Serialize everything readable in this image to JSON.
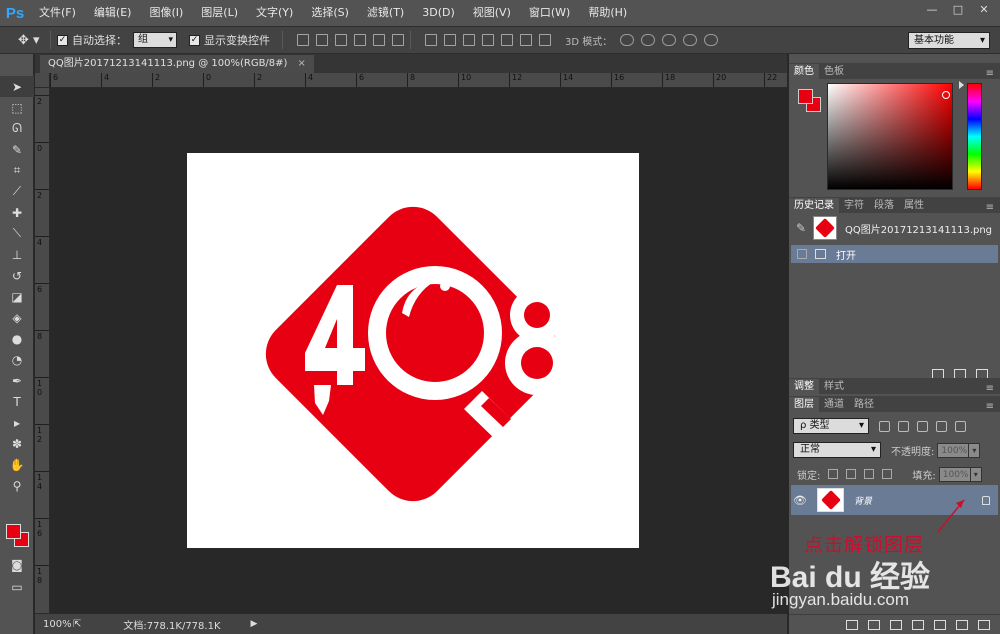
{
  "menubar": {
    "logo": "Ps",
    "items": [
      "文件(F)",
      "编辑(E)",
      "图像(I)",
      "图层(L)",
      "文字(Y)",
      "选择(S)",
      "滤镜(T)",
      "3D(D)",
      "视图(V)",
      "窗口(W)",
      "帮助(H)"
    ],
    "window_controls": [
      "—",
      "□",
      "✕"
    ]
  },
  "options": {
    "auto_select_label": "自动选择：",
    "auto_select_value": "组",
    "show_transform_label": "显示变换控件",
    "mode3d_label": "3D 模式：",
    "workspace": "基本功能"
  },
  "document": {
    "tab_title": "QQ图片20171213141113.png @ 100%(RGB/8#)",
    "close": "×",
    "ruler_h_ticks": [
      "6",
      "4",
      "2",
      "0",
      "2",
      "4",
      "6",
      "8",
      "10",
      "12",
      "14",
      "16",
      "18",
      "20",
      "22"
    ],
    "ruler_v_ticks": [
      "2",
      "0",
      "2",
      "4",
      "6",
      "8",
      "1\n0",
      "1\n2",
      "1\n4",
      "1\n6",
      "1\n8"
    ],
    "logo_text": "408"
  },
  "status": {
    "zoom": "100%",
    "doc_info": "文档:778.1K/778.1K",
    "arrow": "▶"
  },
  "color_panel": {
    "tabs": [
      "颜色",
      "色板"
    ],
    "fg_color": "#e60012",
    "bg_color": "#e60012"
  },
  "history_panel": {
    "tabs": [
      "历史记录",
      "字符",
      "段落",
      "属性"
    ],
    "snapshot_name": "QQ图片20171213141113.png",
    "step_name": "打开"
  },
  "adjust_panel": {
    "tabs": [
      "调整",
      "样式"
    ]
  },
  "layers_panel": {
    "tabs": [
      "图层",
      "通道",
      "路径"
    ],
    "filter": "ρ 类型",
    "blend_mode": "正常",
    "opacity_label": "不透明度:",
    "opacity_value": "100%",
    "lock_label": "锁定:",
    "fill_label": "填充:",
    "fill_value": "100%",
    "layer_name": "背景"
  },
  "annotation": {
    "text": "点击解锁图层"
  },
  "watermark": {
    "brand": "Bai du 经验",
    "url": "jingyan.baidu.com"
  },
  "colors": {
    "brand_red": "#e60012",
    "selection_blue": "#6a7b95",
    "annotation_red": "#c8102e"
  }
}
